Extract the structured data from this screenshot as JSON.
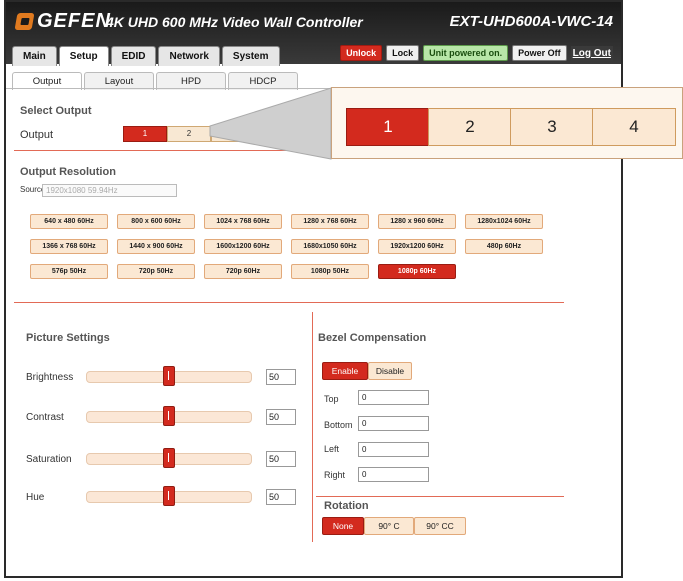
{
  "header": {
    "brand": "GEFEN",
    "title": "4K UHD 600 MHz Video Wall Controller",
    "model": "EXT-UHD600A-VWC-14"
  },
  "main_tabs": [
    {
      "label": "Main"
    },
    {
      "label": "Setup",
      "active": true
    },
    {
      "label": "EDID"
    },
    {
      "label": "Network"
    },
    {
      "label": "System"
    }
  ],
  "controls": {
    "unlock": "Unlock",
    "lock": "Lock",
    "status": "Unit powered on.",
    "power_off": "Power Off",
    "logout": "Log Out"
  },
  "sub_tabs": [
    {
      "label": "Output",
      "active": true
    },
    {
      "label": "Layout"
    },
    {
      "label": "HPD"
    },
    {
      "label": "HDCP"
    }
  ],
  "select_output": {
    "title": "Select Output",
    "label": "Output",
    "options": [
      "1",
      "2",
      "3",
      "4"
    ],
    "selected": "1"
  },
  "output_resolution": {
    "title": "Output Resolution",
    "source_label": "Source",
    "source_value": "1920x1080 59.94Hz",
    "options": [
      "640 x 480 60Hz",
      "800 x 600 60Hz",
      "1024 x 768 60Hz",
      "1280 x 768 60Hz",
      "1280 x 960 60Hz",
      "1280x1024 60Hz",
      "1366 x 768 60Hz",
      "1440 x 900 60Hz",
      "1600x1200 60Hz",
      "1680x1050 60Hz",
      "1920x1200 60Hz",
      "480p 60Hz",
      "576p 50Hz",
      "720p 50Hz",
      "720p 60Hz",
      "1080p 50Hz",
      "1080p 60Hz"
    ],
    "selected": "1080p 60Hz"
  },
  "picture_settings": {
    "title": "Picture Settings",
    "sliders": [
      {
        "label": "Brightness",
        "value": "50",
        "fraction": 0.5
      },
      {
        "label": "Contrast",
        "value": "50",
        "fraction": 0.5
      },
      {
        "label": "Saturation",
        "value": "50",
        "fraction": 0.5
      },
      {
        "label": "Hue",
        "value": "50",
        "fraction": 0.5
      }
    ]
  },
  "bezel": {
    "title": "Bezel Compensation",
    "enable": "Enable",
    "disable": "Disable",
    "fields": [
      {
        "label": "Top",
        "value": "0"
      },
      {
        "label": "Bottom",
        "value": "0"
      },
      {
        "label": "Left",
        "value": "0"
      },
      {
        "label": "Right",
        "value": "0"
      }
    ]
  },
  "rotation": {
    "title": "Rotation",
    "options": [
      "None",
      "90° C",
      "90° CC"
    ],
    "selected": "None"
  },
  "colors": {
    "accent": "#d32a1e",
    "button_bg": "#fbe8d3",
    "divider": "#e26a56"
  }
}
